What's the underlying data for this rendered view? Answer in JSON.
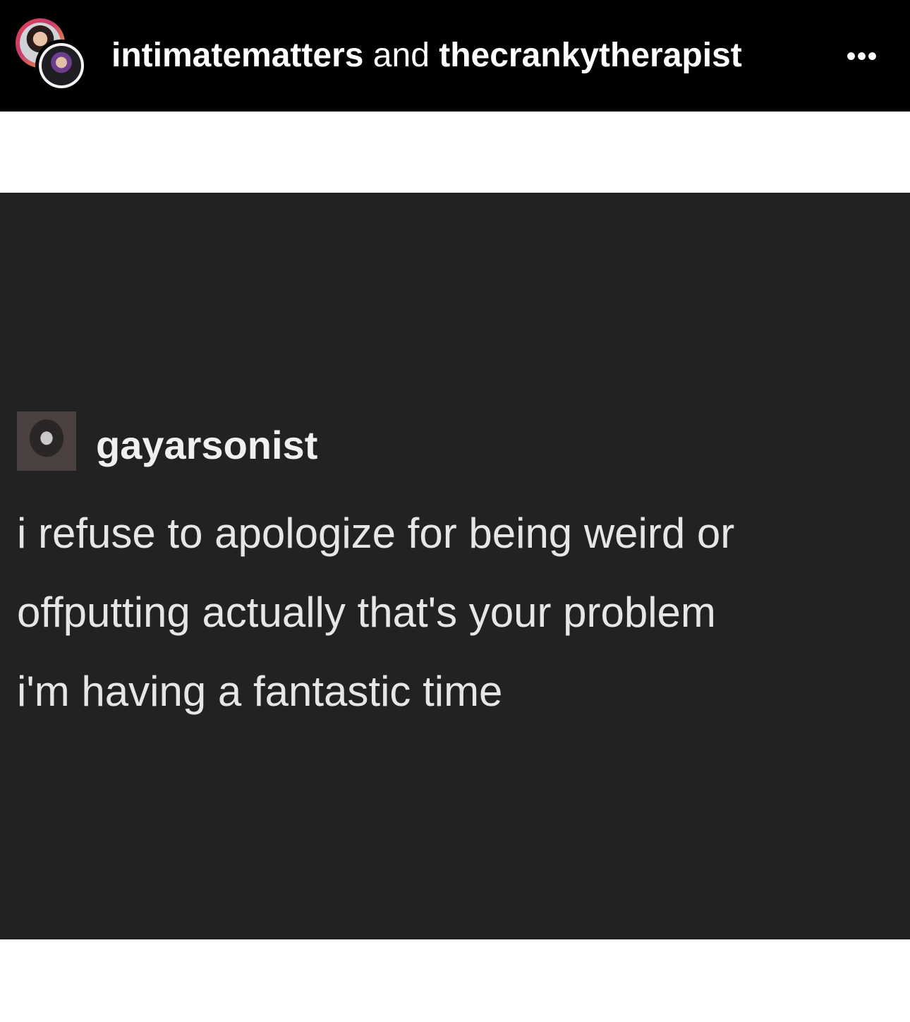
{
  "header": {
    "user1": "intimatematters",
    "conjunction": "and",
    "user2": "thecrankytherapist",
    "more_label": "•••",
    "avatars": [
      "avatar-intimatematters",
      "avatar-thecrankytherapist"
    ]
  },
  "post": {
    "poster_name": "gayarsonist",
    "lines": [
      "i refuse to apologize for being weird or",
      "offputting actually that's your problem",
      "i'm having a fantastic time"
    ]
  },
  "colors": {
    "header_bg": "#000000",
    "post_bg": "#222223",
    "page_bg": "#ffffff",
    "text_light": "#e6e6e6"
  }
}
